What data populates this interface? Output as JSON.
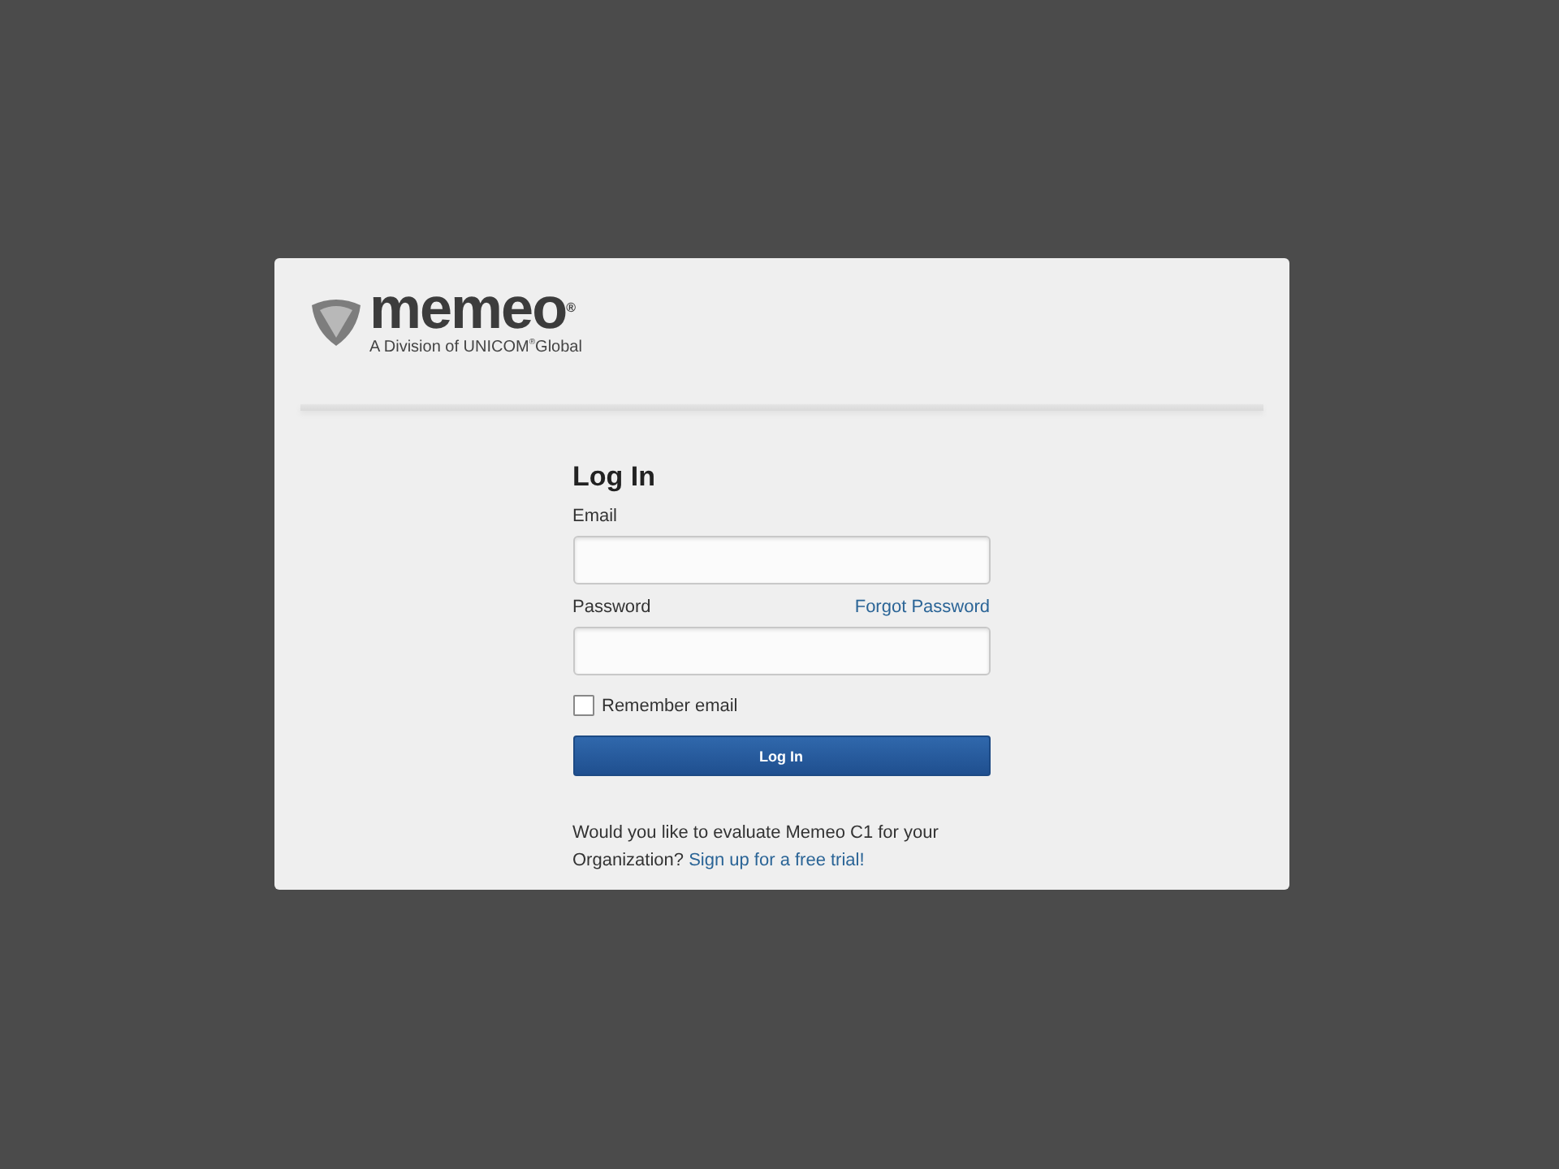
{
  "logo": {
    "wordmark": "memeo$^{®}$",
    "tagline": "A Division of UNICOM$^{®}$Global"
  },
  "form": {
    "title": "Log In",
    "email_label": "Email",
    "password_label": "Password",
    "forgot_link": "Forgot Password",
    "remember": {
      "label": "Remember email",
      "checked": false
    },
    "submit": "Log In"
  },
  "footer": {
    "text": "Would you like to evaluate Memeo C1 for your Organization?",
    "link": "Sign up for a free trial!"
  }
}
